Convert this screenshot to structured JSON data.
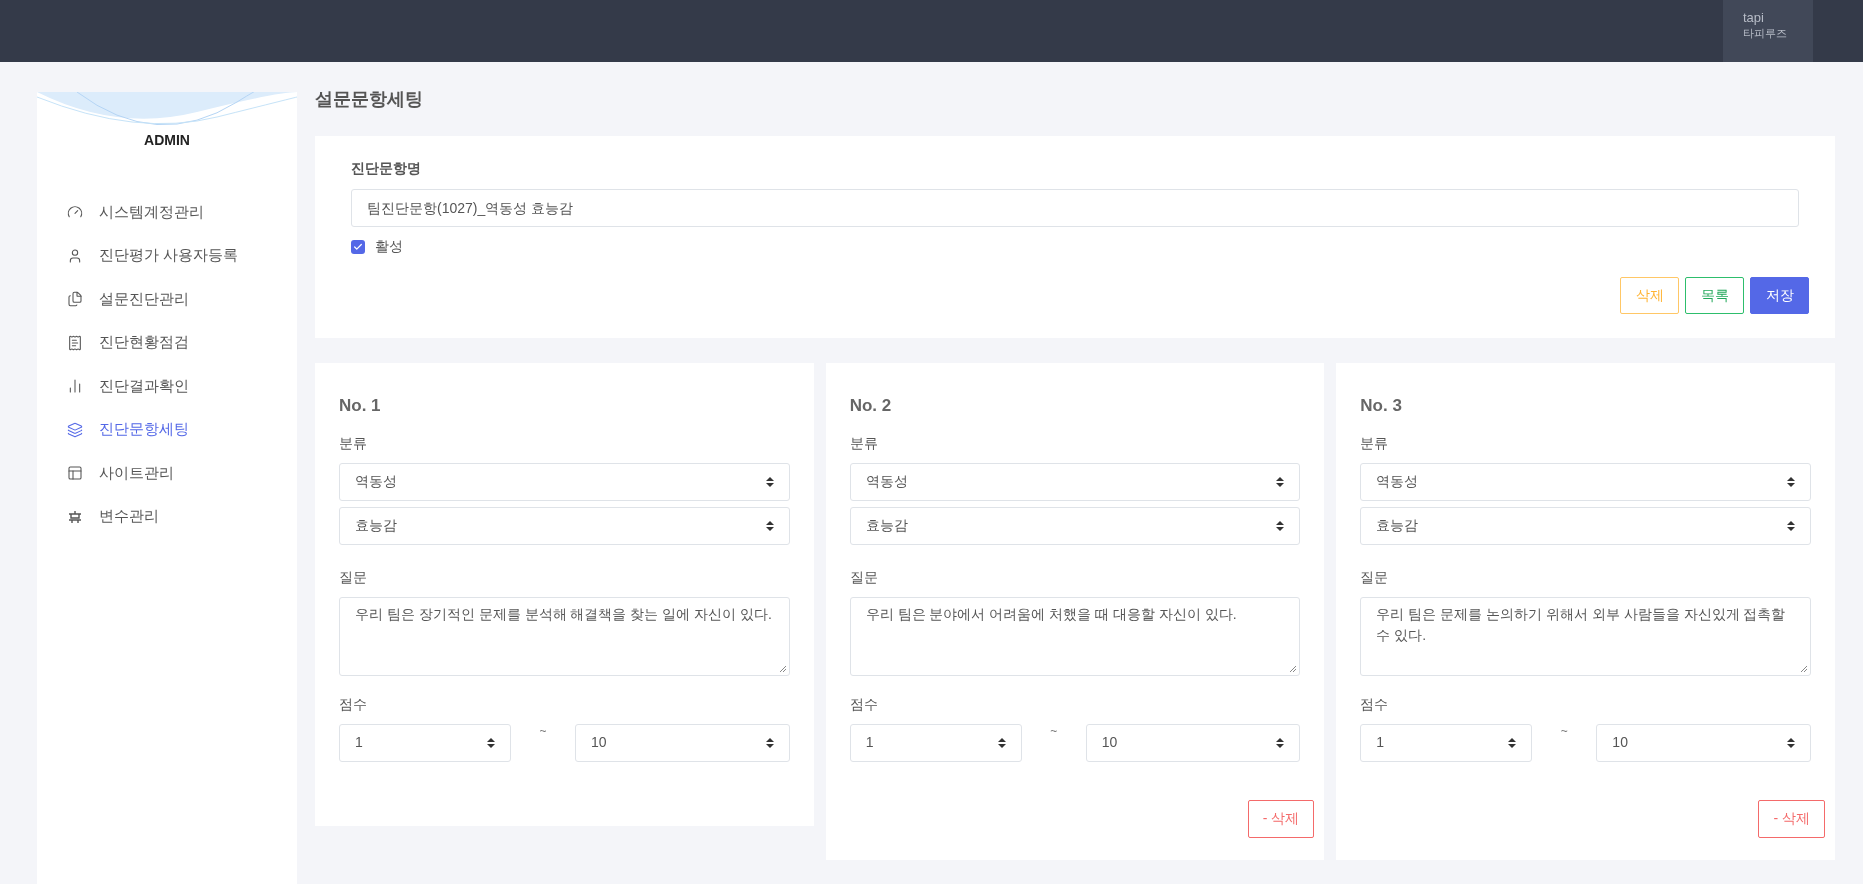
{
  "top_bar": {
    "user_id": "tapi",
    "user_name": "타피루즈"
  },
  "sidebar": {
    "title": "ADMIN",
    "items": [
      {
        "label": "시스템계정관리",
        "selected": false
      },
      {
        "label": "진단평가 사용자등록",
        "selected": false
      },
      {
        "label": "설문진단관리",
        "selected": false
      },
      {
        "label": "진단현황점검",
        "selected": false
      },
      {
        "label": "진단결과확인",
        "selected": false
      },
      {
        "label": "진단문항세팅",
        "selected": true
      },
      {
        "label": "사이트관리",
        "selected": false
      },
      {
        "label": "변수관리",
        "selected": false
      }
    ]
  },
  "page_title": "설문문항세팅",
  "form": {
    "name_label": "진단문항명",
    "name_value": "팀진단문항(1027)_역동성 효능감",
    "active_label": "활성",
    "active_checked": true,
    "buttons": [
      {
        "label": "삭제",
        "kind": "warning"
      },
      {
        "label": "목록",
        "kind": "success"
      },
      {
        "label": "저장",
        "kind": "primary"
      }
    ]
  },
  "questions": [
    {
      "number": "No. 1",
      "category_label": "분류",
      "category": "역동성",
      "subcategory": "효능감",
      "question_label": "질문",
      "question": "우리 팀은 장기적인 문제를 분석해 해결책을 찾는 일에 자신이 있다.",
      "score_label": "점수",
      "score_min": "1",
      "range_sep": "~",
      "score_max": "10"
    },
    {
      "number": "No. 2",
      "category_label": "분류",
      "category": "역동성",
      "subcategory": "효능감",
      "question_label": "질문",
      "question": "우리 팀은 분야에서 어려움에 처했을 때 대응할 자신이 있다.",
      "score_label": "점수",
      "score_min": "1",
      "range_sep": "~",
      "score_max": "10",
      "delete_label": "- 삭제"
    },
    {
      "number": "No. 3",
      "category_label": "분류",
      "category": "역동성",
      "subcategory": "효능감",
      "question_label": "질문",
      "question": "우리 팀은 문제를 논의하기 위해서 외부 사람들을 자신있게 접촉할 수 있다.",
      "score_label": "점수",
      "score_min": "1",
      "range_sep": "~",
      "score_max": "10",
      "delete_label": "- 삭제"
    }
  ]
}
